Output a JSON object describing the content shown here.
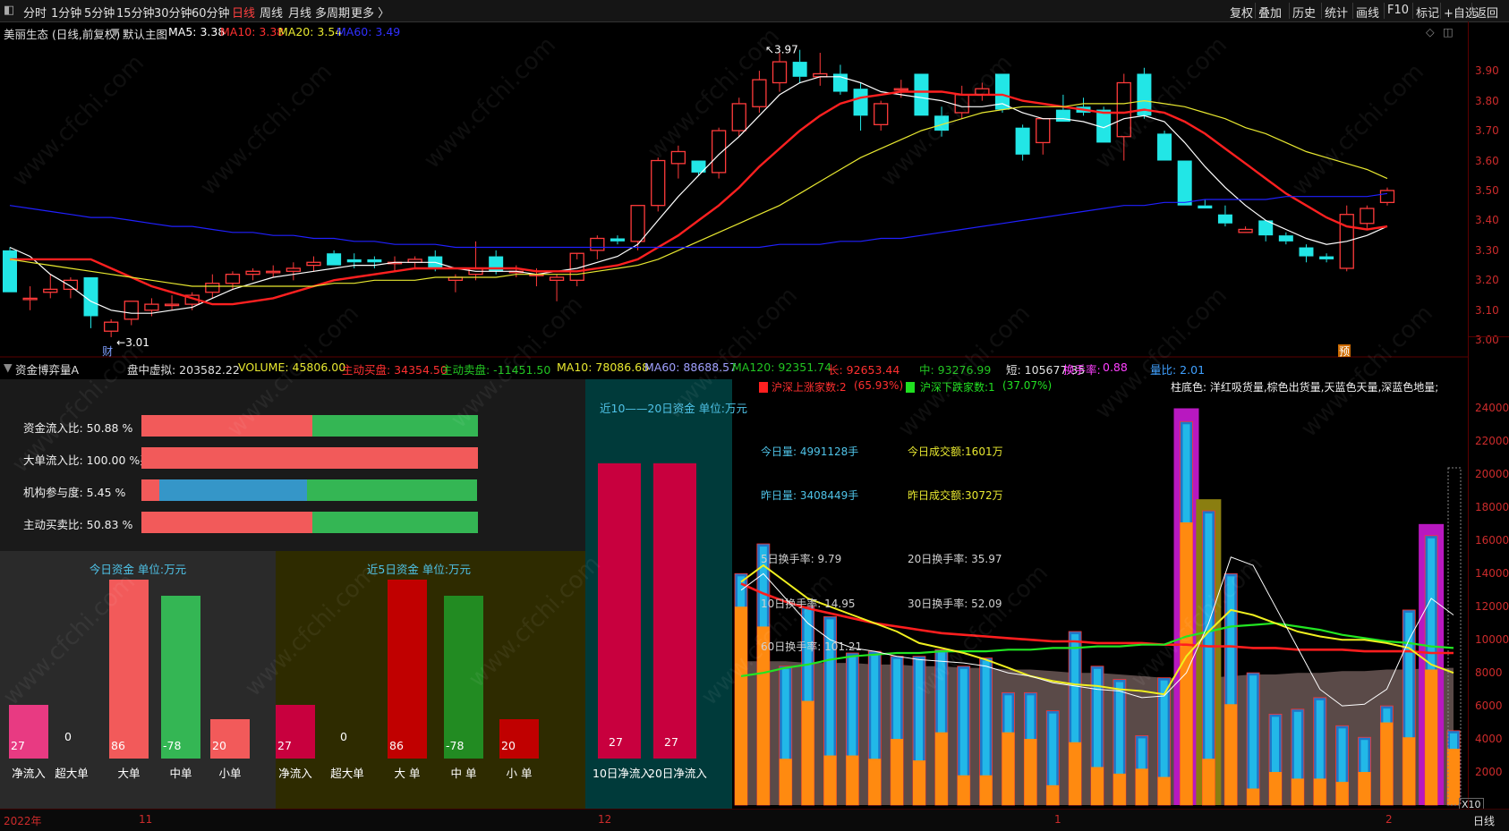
{
  "toolbar": {
    "left": [
      "分时",
      "1分钟",
      "5分钟",
      "15分钟",
      "30分钟",
      "60分钟",
      "日线",
      "周线",
      "月线",
      "多周期",
      "更多 〉"
    ],
    "active_index": 6,
    "right": [
      "复权",
      "叠加",
      "历史",
      "统计",
      "画线",
      "F10",
      "标记",
      "+自选",
      "返回"
    ]
  },
  "main_info": {
    "stock": "美丽生态 (日线,前复权)",
    "template": "默认主图",
    "ma5": "MA5: 3.38",
    "ma10": "MA10: 3.38",
    "ma20": "MA20: 3.54",
    "ma60": "MA60: 3.49"
  },
  "price_axis": [
    "3.90",
    "3.80",
    "3.70",
    "3.60",
    "3.50",
    "3.40",
    "3.30",
    "3.20",
    "3.10",
    "3.00"
  ],
  "price_annotations": {
    "high": "3.97",
    "low": "3.01",
    "mark_cai": "财",
    "mark_yu": "预"
  },
  "indicator_info": {
    "name": "资金博弈量A",
    "pan": "盘中虚拟: 203582.22",
    "volume": "VOLUME: 45806.00",
    "buy": "主动买盘: 34354.50",
    "sell": "主动卖盘: -11451.50",
    "ma10": "MA10: 78086.68",
    "ma60": "MA60: 88688.57",
    "ma120": "MA120: 92351.74",
    "chang": "长: 92653.44",
    "zhong": "中: 93276.99",
    "duan": "短: 105677.35",
    "turnover_label": "换手率:",
    "turnover": "0.88",
    "volratio": "量比: 2.01"
  },
  "vol_axis": [
    "24000",
    "22000",
    "20000",
    "18000",
    "16000",
    "14000",
    "12000",
    "10000",
    "8000",
    "6000",
    "4000",
    "2000"
  ],
  "vol_axis_unit": "X10",
  "ratios": [
    {
      "label": "资金流入比: 50.88 %",
      "segments": [
        {
          "w": 0.5088,
          "color": "#f25a5a"
        },
        {
          "w": 0.4912,
          "color": "#34b654"
        }
      ]
    },
    {
      "label": "大单流入比: 100.00 %买",
      "segments": [
        {
          "w": 1.0,
          "color": "#f25a5a"
        }
      ]
    },
    {
      "label": "机构参与度: 5.45 %",
      "segments": [
        {
          "w": 0.0545,
          "color": "#f25a5a"
        },
        {
          "w": 0.44,
          "color": "#3596c8"
        },
        {
          "w": 0.5055,
          "color": "#34b654"
        }
      ]
    },
    {
      "label": "主动买卖比: 50.83 %",
      "segments": [
        {
          "w": 0.5083,
          "color": "#f25a5a"
        },
        {
          "w": 0.4917,
          "color": "#34b654"
        }
      ]
    }
  ],
  "today_panel": {
    "title": "今日资金   单位:万元",
    "bars": [
      {
        "cat": "净流入",
        "val": "27",
        "h": 0.26,
        "color": "#e83a82"
      },
      {
        "cat": "超大单",
        "val": "0",
        "h": 0,
        "color": "#e83a82"
      },
      {
        "cat": "大单",
        "val": "86",
        "h": 0.87,
        "color": "#f25a5a"
      },
      {
        "cat": "中单",
        "val": "-78",
        "h": 0.79,
        "color": "#34b654"
      },
      {
        "cat": "小单",
        "val": "20",
        "h": 0.19,
        "color": "#f25a5a"
      }
    ]
  },
  "five_panel": {
    "title": "近5日资金   单位:万元",
    "bars": [
      {
        "cat": "净流入",
        "val": "27",
        "h": 0.26,
        "color": "#c8003e"
      },
      {
        "cat": "超大单",
        "val": "0",
        "h": 0,
        "color": "#c8003e"
      },
      {
        "cat": "大  单",
        "val": "86",
        "h": 0.87,
        "color": "#c00000"
      },
      {
        "cat": "中  单",
        "val": "-78",
        "h": 0.79,
        "color": "#228b22"
      },
      {
        "cat": "小  单",
        "val": "20",
        "h": 0.19,
        "color": "#c00000"
      }
    ]
  },
  "ten_panel": {
    "title": "近10——20日资金   单位:万元",
    "bars": [
      {
        "cat": "10日净流入",
        "val": "27",
        "h": 1.0,
        "color": "#c8003e"
      },
      {
        "cat": "20日净流入",
        "val": "27",
        "h": 1.0,
        "color": "#c8003e"
      }
    ]
  },
  "stats": {
    "up_label": "沪深上涨家数:2",
    "up_pct": "(65.93%)",
    "down_label": "沪深下跌家数:1",
    "down_pct": "(37.07%)",
    "legend": "柱底色: 洋红吸货量,棕色出货量,天蓝色天量,深蓝色地量;",
    "today_vol": "今日量: 4991128手",
    "today_amt": "今日成交额:1601万",
    "yest_vol": "昨日量: 3408449手",
    "yest_amt": "昨日成交额:3072万",
    "t5": "5日换手率:   9.79",
    "t20": "20日换手率:   35.97",
    "t10": "10日换手率:   14.95",
    "t30": "30日换手率:   52.09",
    "t60": "60日换手率:   101.21"
  },
  "bottom": {
    "year": "2022年",
    "m11": "11",
    "m12": "12",
    "m1": "1",
    "m2": "2",
    "right": "日线"
  },
  "watermark": "www.cfchi.com",
  "chart_data": {
    "type": "candlestick",
    "title": "美丽生态 (日线,前复权)",
    "ylim": [
      2.95,
      3.99
    ],
    "candles": [
      {
        "o": 3.3,
        "h": 3.31,
        "l": 3.16,
        "c": 3.16
      },
      {
        "o": 3.14,
        "h": 3.18,
        "l": 3.1,
        "c": 3.14
      },
      {
        "o": 3.16,
        "h": 3.22,
        "l": 3.14,
        "c": 3.17
      },
      {
        "o": 3.17,
        "h": 3.21,
        "l": 3.14,
        "c": 3.2
      },
      {
        "o": 3.21,
        "h": 3.21,
        "l": 3.04,
        "c": 3.08
      },
      {
        "o": 3.03,
        "h": 3.07,
        "l": 3.01,
        "c": 3.06
      },
      {
        "o": 3.07,
        "h": 3.13,
        "l": 3.05,
        "c": 3.13
      },
      {
        "o": 3.1,
        "h": 3.14,
        "l": 3.08,
        "c": 3.12
      },
      {
        "o": 3.12,
        "h": 3.15,
        "l": 3.1,
        "c": 3.12
      },
      {
        "o": 3.12,
        "h": 3.16,
        "l": 3.1,
        "c": 3.15
      },
      {
        "o": 3.16,
        "h": 3.22,
        "l": 3.14,
        "c": 3.19
      },
      {
        "o": 3.19,
        "h": 3.23,
        "l": 3.17,
        "c": 3.22
      },
      {
        "o": 3.22,
        "h": 3.24,
        "l": 3.2,
        "c": 3.23
      },
      {
        "o": 3.23,
        "h": 3.25,
        "l": 3.21,
        "c": 3.23
      },
      {
        "o": 3.23,
        "h": 3.26,
        "l": 3.2,
        "c": 3.24
      },
      {
        "o": 3.25,
        "h": 3.28,
        "l": 3.23,
        "c": 3.26
      },
      {
        "o": 3.29,
        "h": 3.3,
        "l": 3.25,
        "c": 3.25
      },
      {
        "o": 3.27,
        "h": 3.29,
        "l": 3.24,
        "c": 3.26
      },
      {
        "o": 3.27,
        "h": 3.28,
        "l": 3.24,
        "c": 3.26
      },
      {
        "o": 3.26,
        "h": 3.28,
        "l": 3.23,
        "c": 3.26
      },
      {
        "o": 3.26,
        "h": 3.28,
        "l": 3.24,
        "c": 3.27
      },
      {
        "o": 3.28,
        "h": 3.3,
        "l": 3.23,
        "c": 3.24
      },
      {
        "o": 3.2,
        "h": 3.22,
        "l": 3.16,
        "c": 3.21
      },
      {
        "o": 3.22,
        "h": 3.33,
        "l": 3.2,
        "c": 3.24
      },
      {
        "o": 3.28,
        "h": 3.3,
        "l": 3.22,
        "c": 3.23
      },
      {
        "o": 3.23,
        "h": 3.25,
        "l": 3.21,
        "c": 3.23
      },
      {
        "o": 3.22,
        "h": 3.24,
        "l": 3.18,
        "c": 3.22
      },
      {
        "o": 3.2,
        "h": 3.22,
        "l": 3.13,
        "c": 3.21
      },
      {
        "o": 3.2,
        "h": 3.27,
        "l": 3.18,
        "c": 3.29
      },
      {
        "o": 3.3,
        "h": 3.35,
        "l": 3.27,
        "c": 3.34
      },
      {
        "o": 3.34,
        "h": 3.35,
        "l": 3.32,
        "c": 3.33
      },
      {
        "o": 3.33,
        "h": 3.45,
        "l": 3.3,
        "c": 3.45
      },
      {
        "o": 3.45,
        "h": 3.61,
        "l": 3.43,
        "c": 3.6
      },
      {
        "o": 3.59,
        "h": 3.65,
        "l": 3.54,
        "c": 3.63
      },
      {
        "o": 3.6,
        "h": 3.6,
        "l": 3.55,
        "c": 3.56
      },
      {
        "o": 3.56,
        "h": 3.71,
        "l": 3.54,
        "c": 3.7
      },
      {
        "o": 3.7,
        "h": 3.81,
        "l": 3.68,
        "c": 3.79
      },
      {
        "o": 3.78,
        "h": 3.9,
        "l": 3.76,
        "c": 3.87
      },
      {
        "o": 3.86,
        "h": 3.96,
        "l": 3.83,
        "c": 3.93
      },
      {
        "o": 3.93,
        "h": 3.97,
        "l": 3.86,
        "c": 3.88
      },
      {
        "o": 3.88,
        "h": 3.96,
        "l": 3.85,
        "c": 3.89
      },
      {
        "o": 3.89,
        "h": 3.92,
        "l": 3.82,
        "c": 3.83
      },
      {
        "o": 3.84,
        "h": 3.86,
        "l": 3.7,
        "c": 3.75
      },
      {
        "o": 3.72,
        "h": 3.8,
        "l": 3.7,
        "c": 3.79
      },
      {
        "o": 3.84,
        "h": 3.87,
        "l": 3.81,
        "c": 3.84
      },
      {
        "o": 3.89,
        "h": 3.89,
        "l": 3.75,
        "c": 3.75
      },
      {
        "o": 3.75,
        "h": 3.78,
        "l": 3.68,
        "c": 3.7
      },
      {
        "o": 3.76,
        "h": 3.85,
        "l": 3.74,
        "c": 3.82
      },
      {
        "o": 3.82,
        "h": 3.86,
        "l": 3.8,
        "c": 3.84
      },
      {
        "o": 3.89,
        "h": 3.89,
        "l": 3.76,
        "c": 3.77
      },
      {
        "o": 3.71,
        "h": 3.72,
        "l": 3.6,
        "c": 3.62
      },
      {
        "o": 3.66,
        "h": 3.74,
        "l": 3.62,
        "c": 3.74
      },
      {
        "o": 3.77,
        "h": 3.82,
        "l": 3.73,
        "c": 3.73
      },
      {
        "o": 3.78,
        "h": 3.81,
        "l": 3.75,
        "c": 3.76
      },
      {
        "o": 3.77,
        "h": 3.78,
        "l": 3.66,
        "c": 3.66
      },
      {
        "o": 3.68,
        "h": 3.89,
        "l": 3.6,
        "c": 3.86
      },
      {
        "o": 3.89,
        "h": 3.91,
        "l": 3.74,
        "c": 3.75
      },
      {
        "o": 3.69,
        "h": 3.7,
        "l": 3.6,
        "c": 3.6
      },
      {
        "o": 3.6,
        "h": 3.6,
        "l": 3.45,
        "c": 3.45
      },
      {
        "o": 3.45,
        "h": 3.47,
        "l": 3.44,
        "c": 3.44
      },
      {
        "o": 3.42,
        "h": 3.45,
        "l": 3.38,
        "c": 3.39
      },
      {
        "o": 3.36,
        "h": 3.38,
        "l": 3.36,
        "c": 3.37
      },
      {
        "o": 3.4,
        "h": 3.4,
        "l": 3.33,
        "c": 3.35
      },
      {
        "o": 3.35,
        "h": 3.36,
        "l": 3.32,
        "c": 3.33
      },
      {
        "o": 3.31,
        "h": 3.32,
        "l": 3.26,
        "c": 3.28
      },
      {
        "o": 3.28,
        "h": 3.29,
        "l": 3.26,
        "c": 3.27
      },
      {
        "o": 3.24,
        "h": 3.45,
        "l": 3.23,
        "c": 3.42
      },
      {
        "o": 3.39,
        "h": 3.45,
        "l": 3.37,
        "c": 3.44
      },
      {
        "o": 3.46,
        "h": 3.51,
        "l": 3.45,
        "c": 3.5
      }
    ],
    "series": [
      {
        "name": "MA5",
        "color": "#ffffff",
        "values": [
          3.31,
          3.28,
          3.22,
          3.18,
          3.13,
          3.1,
          3.09,
          3.09,
          3.1,
          3.11,
          3.14,
          3.17,
          3.19,
          3.21,
          3.22,
          3.23,
          3.24,
          3.25,
          3.25,
          3.26,
          3.26,
          3.26,
          3.24,
          3.23,
          3.23,
          3.23,
          3.22,
          3.23,
          3.24,
          3.26,
          3.28,
          3.32,
          3.4,
          3.48,
          3.55,
          3.62,
          3.68,
          3.75,
          3.82,
          3.86,
          3.88,
          3.88,
          3.86,
          3.83,
          3.82,
          3.81,
          3.8,
          3.78,
          3.78,
          3.79,
          3.76,
          3.74,
          3.74,
          3.73,
          3.71,
          3.74,
          3.75,
          3.73,
          3.66,
          3.58,
          3.51,
          3.45,
          3.4,
          3.37,
          3.34,
          3.32,
          3.33,
          3.35,
          3.38
        ]
      },
      {
        "name": "MA10",
        "color": "#ff2020",
        "values": [
          3.27,
          3.27,
          3.27,
          3.27,
          3.27,
          3.24,
          3.21,
          3.18,
          3.16,
          3.14,
          3.12,
          3.12,
          3.13,
          3.14,
          3.16,
          3.18,
          3.2,
          3.21,
          3.22,
          3.23,
          3.24,
          3.24,
          3.24,
          3.24,
          3.24,
          3.24,
          3.23,
          3.23,
          3.23,
          3.24,
          3.25,
          3.27,
          3.31,
          3.35,
          3.4,
          3.45,
          3.51,
          3.58,
          3.64,
          3.7,
          3.75,
          3.79,
          3.81,
          3.82,
          3.83,
          3.83,
          3.83,
          3.82,
          3.82,
          3.82,
          3.8,
          3.79,
          3.78,
          3.77,
          3.76,
          3.76,
          3.77,
          3.76,
          3.73,
          3.69,
          3.64,
          3.59,
          3.54,
          3.49,
          3.45,
          3.41,
          3.38,
          3.37,
          3.38
        ]
      },
      {
        "name": "MA20",
        "color": "#e8e830",
        "values": [
          3.27,
          3.26,
          3.25,
          3.24,
          3.23,
          3.22,
          3.21,
          3.2,
          3.19,
          3.18,
          3.18,
          3.18,
          3.18,
          3.18,
          3.18,
          3.18,
          3.19,
          3.19,
          3.2,
          3.2,
          3.2,
          3.21,
          3.21,
          3.21,
          3.21,
          3.22,
          3.22,
          3.22,
          3.22,
          3.23,
          3.24,
          3.25,
          3.27,
          3.3,
          3.33,
          3.36,
          3.39,
          3.42,
          3.45,
          3.49,
          3.53,
          3.57,
          3.61,
          3.64,
          3.67,
          3.7,
          3.72,
          3.74,
          3.76,
          3.77,
          3.78,
          3.78,
          3.78,
          3.79,
          3.79,
          3.79,
          3.8,
          3.79,
          3.78,
          3.76,
          3.74,
          3.71,
          3.69,
          3.66,
          3.63,
          3.61,
          3.59,
          3.57,
          3.54
        ]
      },
      {
        "name": "MA60",
        "color": "#2020ff",
        "values": [
          3.45,
          3.44,
          3.43,
          3.42,
          3.41,
          3.41,
          3.4,
          3.39,
          3.38,
          3.38,
          3.37,
          3.36,
          3.36,
          3.35,
          3.35,
          3.34,
          3.34,
          3.33,
          3.33,
          3.32,
          3.32,
          3.32,
          3.31,
          3.31,
          3.31,
          3.31,
          3.31,
          3.31,
          3.31,
          3.31,
          3.31,
          3.31,
          3.31,
          3.31,
          3.31,
          3.31,
          3.31,
          3.31,
          3.32,
          3.32,
          3.32,
          3.33,
          3.33,
          3.34,
          3.34,
          3.35,
          3.36,
          3.37,
          3.38,
          3.39,
          3.4,
          3.41,
          3.42,
          3.43,
          3.44,
          3.45,
          3.45,
          3.46,
          3.46,
          3.47,
          3.47,
          3.47,
          3.47,
          3.48,
          3.48,
          3.48,
          3.48,
          3.48,
          3.49
        ]
      }
    ],
    "volume": {
      "ylim": [
        0,
        25000
      ],
      "total": [
        14000,
        15800,
        8400,
        12000,
        11400,
        9200,
        9300,
        9000,
        9000,
        9400,
        8400,
        8900,
        6800,
        6800,
        5700,
        10500,
        8400,
        7600,
        4200,
        7700,
        23200,
        17800,
        14000,
        8000,
        5500,
        5800,
        6500,
        4800,
        4100,
        6000,
        11800,
        16300,
        4500
      ],
      "active": [
        12000,
        10800,
        2800,
        6300,
        3000,
        3000,
        2800,
        4000,
        2700,
        4400,
        1800,
        1800,
        4400,
        4000,
        1200,
        3800,
        2300,
        1900,
        2200,
        1700,
        17100,
        2800,
        6100,
        1000,
        2000,
        1600,
        1600,
        1400,
        2000,
        5000,
        4100,
        8200,
        3400
      ],
      "special": [
        {
          "index": 20,
          "value": 24000,
          "kind": "洋红吸货量"
        },
        {
          "index": 21,
          "value": 18500,
          "kind": "棕色出货量"
        },
        {
          "index": 31,
          "value": 17000,
          "kind": "洋红吸货量"
        }
      ],
      "line_white": [
        13000,
        14000,
        12500,
        11000,
        10000,
        9500,
        9300,
        9000,
        8800,
        8700,
        8600,
        8400,
        8000,
        7800,
        7400,
        7200,
        7000,
        6900,
        6500,
        6600,
        8000,
        11000,
        15000,
        14500,
        12000,
        9500,
        7000,
        6000,
        6100,
        7000,
        10000,
        12500,
        11500
      ],
      "line_yellow": [
        13500,
        14500,
        13500,
        12500,
        12000,
        11500,
        11000,
        10500,
        9800,
        9500,
        9200,
        8800,
        8300,
        7800,
        7500,
        7300,
        7200,
        7000,
        6900,
        6700,
        9000,
        10500,
        11800,
        11500,
        11000,
        10500,
        10200,
        10000,
        10000,
        9800,
        9500,
        8500,
        8000
      ],
      "line_red": [
        13400,
        12800,
        12300,
        11900,
        11600,
        11300,
        11000,
        10800,
        10600,
        10400,
        10300,
        10200,
        10100,
        10000,
        9900,
        9900,
        9800,
        9800,
        9800,
        9700,
        9700,
        9600,
        9600,
        9500,
        9500,
        9400,
        9400,
        9400,
        9300,
        9300,
        9300,
        9200,
        9200
      ],
      "line_green": [
        7800,
        8000,
        8300,
        8500,
        8800,
        9000,
        9100,
        9200,
        9200,
        9300,
        9300,
        9300,
        9400,
        9400,
        9500,
        9500,
        9600,
        9600,
        9700,
        9700,
        10200,
        10500,
        10800,
        10900,
        11000,
        10800,
        10600,
        10300,
        10100,
        9900,
        9800,
        9600,
        9500
      ],
      "area_brown": [
        8700,
        8700,
        8700,
        8600,
        8600,
        8600,
        8500,
        8500,
        8400,
        8400,
        8300,
        8300,
        8200,
        8200,
        8100,
        8000,
        8000,
        7900,
        7800,
        7700,
        7700,
        7700,
        7800,
        7900,
        7900,
        8000,
        8000,
        8100,
        8100,
        8200,
        8200,
        8300,
        8300
      ]
    }
  }
}
